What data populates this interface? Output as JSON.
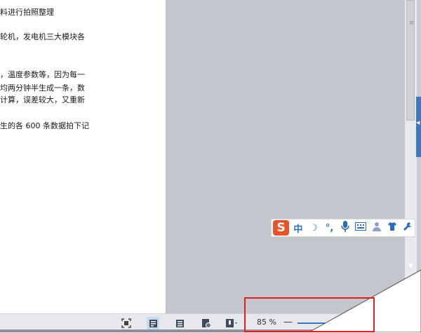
{
  "document": {
    "lines": [
      "料进行拍照整理",
      "轮机，发电机三大模块各",
      "，温度参数等，因为每一",
      "均两分钟半生成一条，数",
      "计算，误差较大，又重新",
      "生的各 600 条数据拍下记"
    ]
  },
  "ime_toolbar": {
    "logo": "S",
    "items": [
      "中",
      "☽",
      "°,",
      "🎙",
      "⌨",
      "👤",
      "👕",
      "🔧"
    ]
  },
  "status_bar": {
    "zoom_label": "85 %",
    "zoom_minus": "—"
  },
  "colors": {
    "accent": "#3b78c8",
    "highlight": "#e02020",
    "ime_brand": "#e8542a"
  }
}
